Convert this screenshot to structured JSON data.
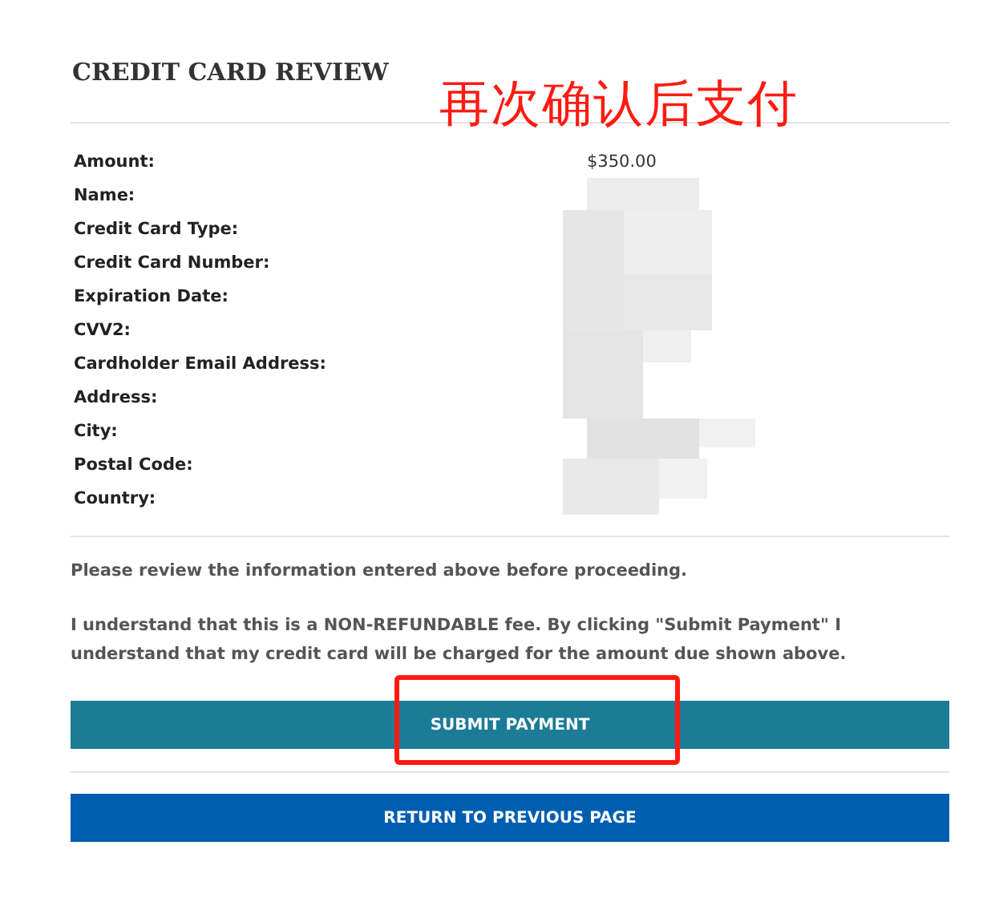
{
  "title": "CREDIT CARD REVIEW",
  "annotation": {
    "text": "再次确认后支付"
  },
  "fields": [
    {
      "label": "Amount:",
      "value": "$350.00"
    },
    {
      "label": "Name:"
    },
    {
      "label": "Credit Card Type:"
    },
    {
      "label": "Credit Card Number:"
    },
    {
      "label": "Expiration Date:"
    },
    {
      "label": "CVV2:"
    },
    {
      "label": "Cardholder Email Address:"
    },
    {
      "label": "Address:"
    },
    {
      "label": "City:"
    },
    {
      "label": "Postal Code:"
    },
    {
      "label": "Country:"
    }
  ],
  "notes": [
    "Please review the information entered above before proceeding.",
    "I understand that this is a NON-REFUNDABLE fee. By clicking \"Submit Payment\" I understand that my credit card will be charged for the amount due shown above."
  ],
  "buttons": [
    {
      "label": "SUBMIT PAYMENT",
      "kind": "primary",
      "highlighted": true
    },
    {
      "label": "RETURN TO PREVIOUS PAGE",
      "kind": "secondary",
      "highlighted": false
    }
  ]
}
